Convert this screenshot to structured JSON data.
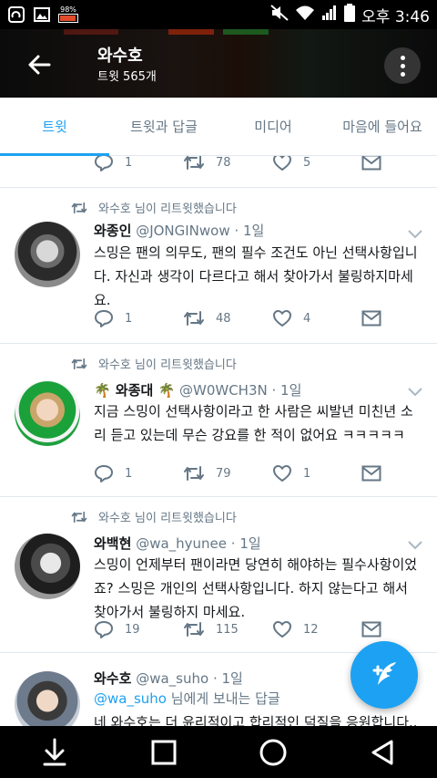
{
  "status_bar": {
    "battery_percent": "98%",
    "time": "오후 3:46",
    "icons": [
      "app-icon",
      "image-icon",
      "battery-saver-icon",
      "mute-icon",
      "wifi-icon",
      "signal-icon",
      "battery-icon"
    ]
  },
  "header": {
    "title": "와수호",
    "subtitle": "트윗 565개"
  },
  "tabs": [
    {
      "label": "트윗",
      "active": true
    },
    {
      "label": "트윗과 답글",
      "active": false
    },
    {
      "label": "미디어",
      "active": false
    },
    {
      "label": "마음에 들어요",
      "active": false
    }
  ],
  "partial_tweet": {
    "reply_count": "1",
    "retweet_count": "78",
    "like_count": "5"
  },
  "tweets": [
    {
      "retweeted_by": "와수호 님이 리트윗했습니다",
      "name": "와종인",
      "handle": "@JONGINwow",
      "time": "· 1일",
      "text": "스밍은 팬의 의무도, 팬의 필수 조건도 아닌 선택사항입니다. 자신과 생각이 다르다고 해서 찾아가서 불링하지마세요.",
      "reply_count": "1",
      "retweet_count": "48",
      "like_count": "4"
    },
    {
      "retweeted_by": "와수호 님이 리트윗했습니다",
      "name": "🌴 와종대 🌴",
      "handle": "@W0WCH3N",
      "time": "· 1일",
      "text": "지금 스밍이 선택사항이라고 한 사람은 씨발년 미친년 소리 듣고 있는데 무슨 강요를 한 적이 없어요 ㅋㅋㅋㅋㅋ",
      "reply_count": "1",
      "retweet_count": "79",
      "like_count": "1"
    },
    {
      "retweeted_by": "와수호 님이 리트윗했습니다",
      "name": "와백현",
      "handle": "@wa_hyunee",
      "time": "· 1일",
      "text": "스밍이 언제부터 팬이라면 당연히 해야하는 필수사항이었죠? 스밍은 개인의 선택사항입니다. 하지 않는다고 해서 찾아가서 불링하지 마세요.",
      "reply_count": "19",
      "retweet_count": "115",
      "like_count": "12"
    },
    {
      "name": "와수호",
      "handle": "@wa_suho",
      "time": "· 1일",
      "reply_mention": "@wa_suho",
      "reply_suffix": "님에게 보내는 답글",
      "text": "네 와수호는 더 윤리적이고 합리적인 덕질을 응원합니다.."
    }
  ],
  "fab": {
    "icon": "compose-tweet-icon"
  },
  "colors": {
    "accent": "#1da1f2",
    "muted": "#657786",
    "text": "#14171a"
  }
}
